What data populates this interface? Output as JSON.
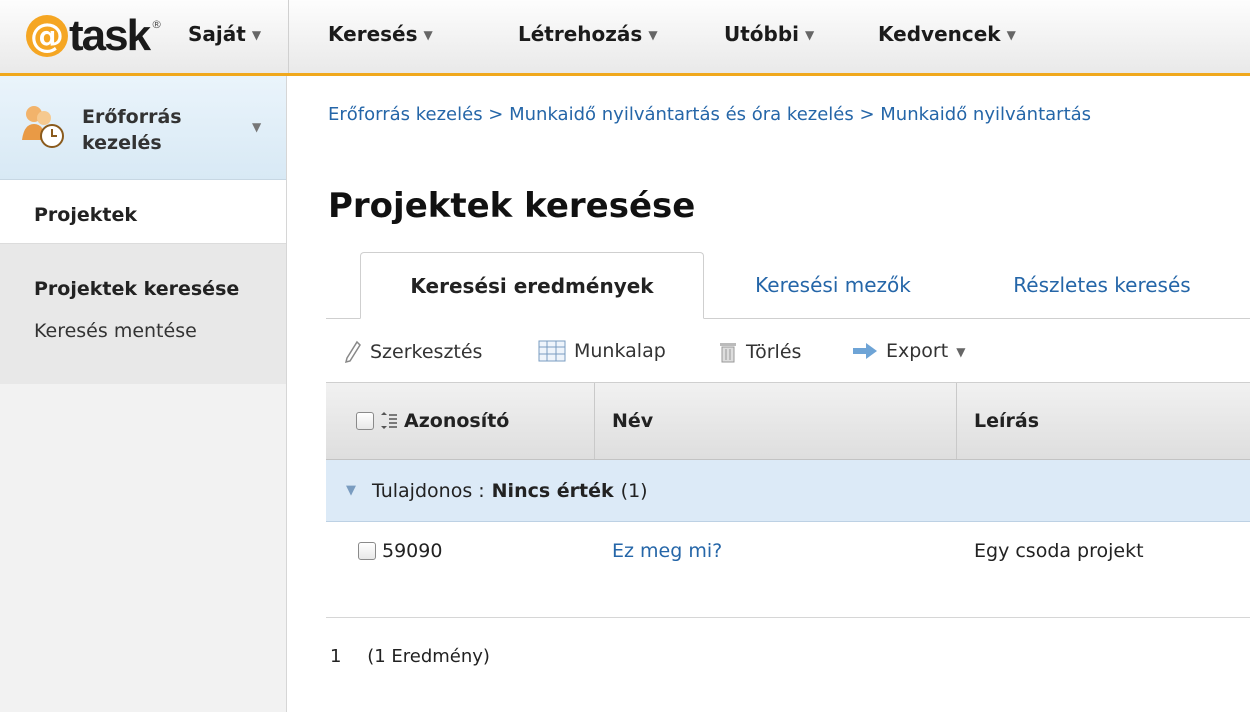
{
  "brand": {
    "logo_text": "task",
    "logo_at": "@"
  },
  "nav": {
    "items": [
      {
        "label": "Saját"
      },
      {
        "label": "Keresés"
      },
      {
        "label": "Létrehozás"
      },
      {
        "label": "Utóbbi"
      },
      {
        "label": "Kedvencek"
      }
    ]
  },
  "sidebar": {
    "workspace_label_line1": "Erőforrás",
    "workspace_label_line2": "kezelés",
    "section": "Projektek",
    "links": [
      {
        "label": "Projektek keresése",
        "active": true
      },
      {
        "label": "Keresés mentése",
        "active": false
      }
    ]
  },
  "main": {
    "breadcrumb": "Erőforrás kezelés > Munkaidő nyilvántartás és óra kezelés > Munkaidő nyilvántartás",
    "title": "Projektek keresése",
    "tabs": [
      {
        "label": "Keresési eredmények",
        "active": true
      },
      {
        "label": "Keresési mezők",
        "active": false
      },
      {
        "label": "Részletes keresés",
        "active": false
      }
    ],
    "toolbar": {
      "edit": "Szerkesztés",
      "worksheet": "Munkalap",
      "delete": "Törlés",
      "export": "Export"
    },
    "columns": [
      "Azonosító",
      "Név",
      "Leírás"
    ],
    "group": {
      "field_label": "Tulajdonos :",
      "value": "Nincs érték",
      "count": "(1)"
    },
    "rows": [
      {
        "id": "59090",
        "name": "Ez meg mi?",
        "description": "Egy csoda projekt"
      }
    ],
    "pager": {
      "page": "1",
      "results": "(1 Eredmény)"
    }
  },
  "colors": {
    "accent": "#f0a81c",
    "link": "#2566a8",
    "group_bg": "#dceaf7"
  }
}
